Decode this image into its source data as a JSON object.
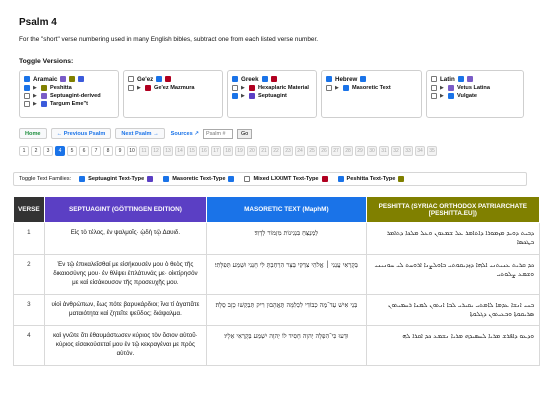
{
  "page": {
    "title": "Psalm 4",
    "note": "For the \"short\" verse numbering used in many English bibles, subtract one from each listed verse number."
  },
  "toggle_versions": {
    "title": "Toggle Versions:",
    "groups": [
      {
        "name": "Aramaic",
        "colors": [
          "#7a5cc7",
          "#808000",
          "#3b5bdb"
        ],
        "checked": true,
        "items": [
          {
            "label": "Peshitta",
            "checked": true,
            "color": "#808000"
          },
          {
            "label": "Septuagint-derived",
            "checked": false,
            "color": "#7a5cc7"
          },
          {
            "label": "Targum Eme\"t",
            "checked": false,
            "color": "#3b5bdb"
          }
        ]
      },
      {
        "name": "Ge'ez",
        "colors": [
          "#1a73e8",
          "#b00020"
        ],
        "checked": false,
        "items": [
          {
            "label": "Ge'ez Mazmura",
            "checked": false,
            "color": "#b00020"
          }
        ]
      },
      {
        "name": "Greek",
        "colors": [
          "#1a73e8",
          "#b00020"
        ],
        "checked": true,
        "items": [
          {
            "label": "Hexaplaric Material",
            "checked": false,
            "color": "#b00020"
          },
          {
            "label": "Septuagint",
            "checked": true,
            "color": "#5b3fc4"
          }
        ]
      },
      {
        "name": "Hebrew",
        "colors": [
          "#1a73e8"
        ],
        "checked": true,
        "items": [
          {
            "label": "Masoretic Text",
            "checked": false,
            "color": "#1a73e8"
          }
        ]
      },
      {
        "name": "Latin",
        "colors": [
          "#1a73e8",
          "#7a5cc7"
        ],
        "checked": false,
        "items": [
          {
            "label": "Vetus Latina",
            "checked": false,
            "color": "#7a5cc7"
          },
          {
            "label": "Vulgate",
            "checked": false,
            "color": "#1a73e8"
          }
        ]
      }
    ]
  },
  "nav": {
    "home": "Home",
    "prev": "← Previous Psalm",
    "next": "Next Psalm →",
    "sources": "Sources ↗",
    "psalm_placeholder": "Psalm #",
    "go": "Go"
  },
  "pages": [
    "1",
    "2",
    "3",
    "4",
    "5",
    "6",
    "7",
    "8",
    "9",
    "10",
    "11",
    "12",
    "13",
    "14",
    "15",
    "16",
    "17",
    "18",
    "19",
    "20",
    "21",
    "22",
    "23",
    "24",
    "25",
    "26",
    "27",
    "28",
    "29",
    "30",
    "31",
    "32",
    "33",
    "34",
    "35"
  ],
  "current_page": "4",
  "text_families": {
    "label": "Toggle Text Families:",
    "items": [
      {
        "label": "Septuagint Text-Type",
        "checked": true,
        "color": "#5b3fc4"
      },
      {
        "label": "Masoretic Text-Type",
        "checked": true,
        "color": "#1a73e8"
      },
      {
        "label": "Mixed LXX/MT Text-Type",
        "checked": false,
        "color": "#b00020"
      },
      {
        "label": "Peshitta Text-Type",
        "checked": true,
        "color": "#808000"
      }
    ]
  },
  "table": {
    "headers": [
      {
        "label": "VERSE",
        "color": "#333333"
      },
      {
        "label": "SEPTUAGINT (GÖTTINGEN EDITION)",
        "color": "#5b3fc4"
      },
      {
        "label": "MASORETIC TEXT (MaphM)",
        "color": "#1a73e8"
      },
      {
        "label": "PESHITTA (SYRIAC ORTHODOX PATRIARCHATE [PESHITTA.EU])",
        "color": "#808000"
      }
    ],
    "rows": [
      {
        "verse": "1",
        "lxx": "Εἰς τὸ τέλος, ἐν ψαλμοῖς· ᾠδὴ τῷ Δαυιδ.",
        "mt": "לַמְנַצֵּחַ בִּנְגִינוֹת מִזְמוֹר לְדָוִד׃",
        "syr": "ܕܒܝܬ ܕܘܝܕ ܡܙܡܘܪܐ ܕܐܬܐܡܪ ܥܠ ܫܡܥܘܢ ܘܥܠ ܡܠܟܐ ܕܬܐܡܪ ܒܛܟܣܐ"
      },
      {
        "verse": "2",
        "lxx": "Ἐν τῷ ἐπικαλεῖσθαί με εἰσήκουσέν μου ὁ θεὸς τῆς δικαιοσύνης μου· ἐν θλίψει ἐπλάτυνάς με· οἰκτίρησόν με καὶ εἰσάκουσον τῆς προσευχῆς μου.",
        "mt": "בְּקָרְאִי עֲנֵנִי ׀ אֱלֹהֵי צִדְקִי בַּצָּר הִרְחַבְתָּ לִּי חָנֵּנִי וּשְׁמַע תְּפִלָּתִי׃",
        "syr": "ܟܕ ܩܪܝܬ ܥܢܝܬܢܝ ܐܠܗܐ ܕܙܕܝܩܘܬܝ ܒܐܘܠܨܢܐ ܐܪܘܚܬ ܠܝ ܚܘܢܝܢܝ ܘܫܡܥ ܨܠܘܬܝ"
      },
      {
        "verse": "3",
        "lxx": "υἱοὶ ἀνθρώπων, ἕως πότε βαρυκάρδιοι; ἵνα τί ἀγαπᾶτε ματαιότητα καὶ ζητεῖτε ψεῦδος; διάψαλμα.",
        "mt": "בְּנֵי אִישׁ עַד־מֶה כְבוֹדִי לִכְלִמָּה תֶּאֱהָבוּן רִיק תְּבַקְשׁוּ כָזָב סֶלָה׃",
        "syr": "ܒܢܝ ܐܢܫܐ ܥܕܡܐ ܠܐܡܬܝ ܝܩܝܪܝ ܠܒܐ ܐܢܬܘܢ ܠܡܢܐ ܪܚܡܝܬܘܢ ܣܪܝܩܘܬܐ ܘܒܥܝܬܘܢ ܕܓܠܘܬܐ"
      },
      {
        "verse": "4",
        "lxx": "καὶ γνῶτε ὅτι ἐθαυμάστωσεν κύριος τὸν ὅσιον αὐτοῦ· κύριος εἰσακούσεταί μου ἐν τῷ κεκραγέναι με πρὸς αὐτόν.",
        "mt": "וּדְעוּ כִּי־הִפְלָה יְהוָה חָסִיד לוֹ יְהוָה יִשְׁמַע בְּקָרְאִי אֵלָיו׃",
        "syr": "ܘܕܥܘ ܕܐܦܪܫ ܡܪܝܐ ܠܚܣܝܕܗ ܡܪܝܐ ܢܫܡܥ ܟܕ ܐܩܪܐ ܠܗ"
      }
    ]
  }
}
